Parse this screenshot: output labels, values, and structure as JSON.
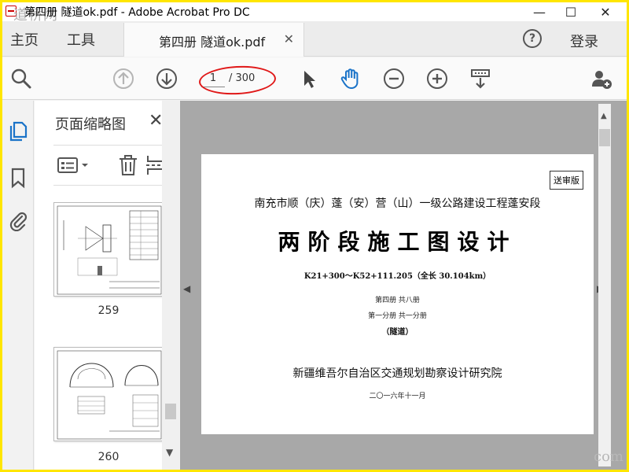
{
  "window": {
    "title": "第四册 隧道ok.pdf - Adobe Acrobat Pro DC",
    "watermark": "道桥网",
    "minimize": "—",
    "maximize": "☐",
    "close": "✕"
  },
  "menubar": {
    "home": "主页",
    "tools": "工具",
    "doc_tab": "第四册 隧道ok.pdf",
    "tab_close": "✕",
    "help": "?",
    "login": "登录"
  },
  "toolbar": {
    "current_page": "1",
    "total_pages": "/ 300",
    "icons": [
      "search-icon",
      "page-up-icon",
      "page-down-icon",
      "select-arrow-icon",
      "hand-icon",
      "zoom-out-icon",
      "zoom-in-icon",
      "scroll-mode-icon",
      "add-user-icon"
    ]
  },
  "left_rail": {
    "icons": [
      "page-thumbnails-icon",
      "bookmark-icon",
      "attachment-icon"
    ]
  },
  "thumbnail_pane": {
    "title": "页面缩略图",
    "close": "✕",
    "tool_icons": [
      "options-menu-icon",
      "delete-icon",
      "split-icon"
    ],
    "thumbnails": [
      {
        "label": "259"
      },
      {
        "label": "260"
      }
    ]
  },
  "document": {
    "review_badge": "送审版",
    "project_title": "南充市顺（庆）蓬（安）营（山）一级公路建设工程蓬安段",
    "main_title": "两阶段施工图设计",
    "mileage": "K21+300～K52+111.205（全长 30.104km）",
    "volume": "第四册   共八册",
    "subvolume": "第一分册   共一分册",
    "section": "（隧道）",
    "institute": "新疆维吾尔自治区交通规划勘察设计研究院",
    "date": "二〇一六年十一月"
  },
  "footer_watermark": "com",
  "colors": {
    "frame": "#ffe600",
    "accent_blue": "#1a73c8",
    "annotation_red": "#e01818"
  }
}
